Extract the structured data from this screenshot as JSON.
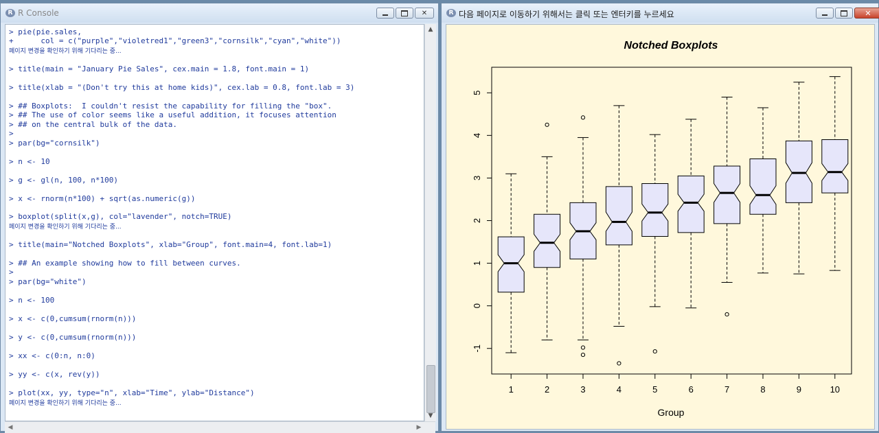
{
  "console": {
    "title": "R Console",
    "lines": [
      "> pie(pie.sales,",
      "+      col = c(\"purple\",\"violetred1\",\"green3\",\"cornsilk\",\"cyan\",\"white\"))",
      "페이지 변경을 확인하기 위해 기다리는 중...",
      "> title(main = \"January Pie Sales\", cex.main = 1.8, font.main = 1)",
      "> title(xlab = \"(Don't try this at home kids)\", cex.lab = 0.8, font.lab = 3)",
      "> ## Boxplots:  I couldn't resist the capability for filling the \"box\".",
      "> ## The use of color seems like a useful addition, it focuses attention",
      "> ## on the central bulk of the data.",
      ">",
      "> par(bg=\"cornsilk\")",
      "> n <- 10",
      "> g <- gl(n, 100, n*100)",
      "> x <- rnorm(n*100) + sqrt(as.numeric(g))",
      "> boxplot(split(x,g), col=\"lavender\", notch=TRUE)",
      "페이지 변경을 확인하기 위해 기다리는 중...",
      "> title(main=\"Notched Boxplots\", xlab=\"Group\", font.main=4, font.lab=1)",
      "> ## An example showing how to fill between curves.",
      ">",
      "> par(bg=\"white\")",
      "> n <- 100",
      "> x <- c(0,cumsum(rnorm(n)))",
      "> y <- c(0,cumsum(rnorm(n)))",
      "> xx <- c(0:n, n:0)",
      "> yy <- c(x, rev(y))",
      "> plot(xx, yy, type=\"n\", xlab=\"Time\", ylab=\"Distance\")",
      "페이지 변경을 확인하기 위해 기다리는 중..."
    ]
  },
  "graphics": {
    "title": "다음 페이지로 이동하기 위해서는 클릭 또는 엔터키를 누르세요",
    "background": "#fff8dc",
    "box_fill": "#e6e6fa"
  },
  "window_buttons": {
    "minimize": "minimize-icon",
    "maximize": "maximize-icon",
    "close": "close-icon"
  },
  "chart_data": {
    "type": "boxplot",
    "title": "Notched Boxplots",
    "xlabel": "Group",
    "ylabel": "",
    "categories": [
      "1",
      "2",
      "3",
      "4",
      "5",
      "6",
      "7",
      "8",
      "9",
      "10"
    ],
    "yticks": [
      -1,
      0,
      1,
      2,
      3,
      4,
      5
    ],
    "ylim": [
      -1.6,
      5.6
    ],
    "notched": true,
    "boxes": [
      {
        "min": -1.1,
        "q1": 0.32,
        "median": 1.0,
        "q3": 1.62,
        "max": 3.1,
        "notch": [
          0.8,
          1.2
        ],
        "outliers": []
      },
      {
        "min": -0.8,
        "q1": 0.9,
        "median": 1.48,
        "q3": 2.15,
        "max": 3.5,
        "notch": [
          1.28,
          1.68
        ],
        "outliers": [
          4.25
        ]
      },
      {
        "min": -0.8,
        "q1": 1.1,
        "median": 1.75,
        "q3": 2.42,
        "max": 3.95,
        "notch": [
          1.55,
          1.95
        ],
        "outliers": [
          -0.98,
          -1.15,
          4.42
        ]
      },
      {
        "min": -0.48,
        "q1": 1.43,
        "median": 1.97,
        "q3": 2.8,
        "max": 4.7,
        "notch": [
          1.75,
          2.2
        ],
        "outliers": [
          -1.35
        ]
      },
      {
        "min": -0.02,
        "q1": 1.63,
        "median": 2.19,
        "q3": 2.87,
        "max": 4.02,
        "notch": [
          1.99,
          2.39
        ],
        "outliers": [
          -1.07
        ]
      },
      {
        "min": -0.05,
        "q1": 1.72,
        "median": 2.42,
        "q3": 3.05,
        "max": 4.38,
        "notch": [
          2.22,
          2.62
        ],
        "outliers": []
      },
      {
        "min": 0.55,
        "q1": 1.93,
        "median": 2.65,
        "q3": 3.28,
        "max": 4.9,
        "notch": [
          2.43,
          2.87
        ],
        "outliers": [
          -0.2
        ]
      },
      {
        "min": 0.77,
        "q1": 2.15,
        "median": 2.6,
        "q3": 3.45,
        "max": 4.65,
        "notch": [
          2.38,
          2.82
        ],
        "outliers": []
      },
      {
        "min": 0.75,
        "q1": 2.42,
        "median": 3.12,
        "q3": 3.87,
        "max": 5.25,
        "notch": [
          2.88,
          3.36
        ],
        "outliers": []
      },
      {
        "min": 0.83,
        "q1": 2.65,
        "median": 3.14,
        "q3": 3.9,
        "max": 5.38,
        "notch": [
          2.94,
          3.34
        ],
        "outliers": []
      }
    ]
  }
}
